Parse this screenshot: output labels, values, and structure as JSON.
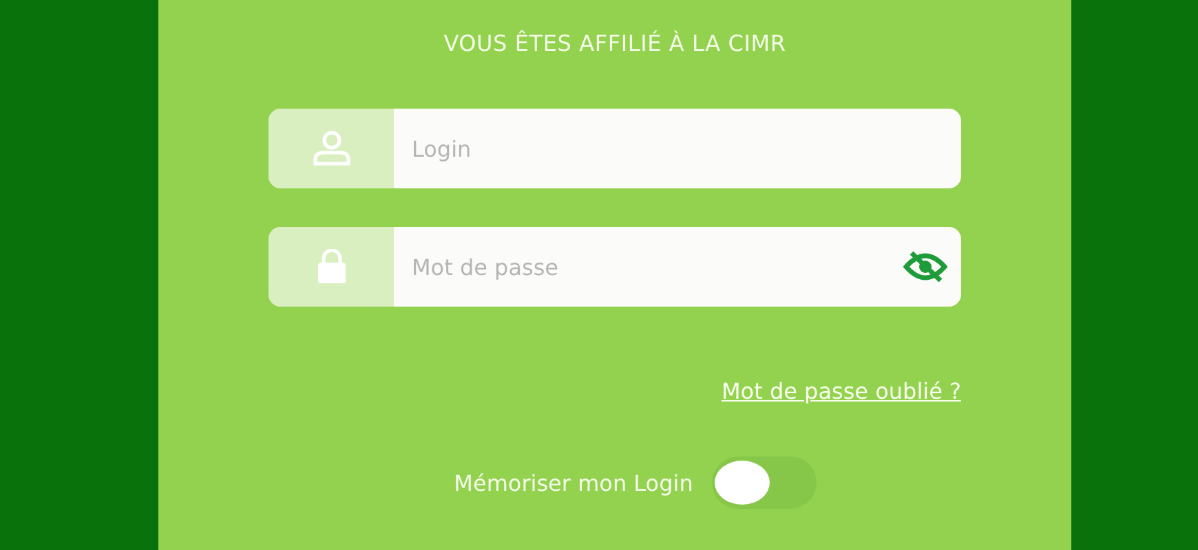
{
  "heading": "VOUS ÊTES AFFILIÉ À LA CIMR",
  "fields": [
    {
      "kind": "user",
      "placeholder": "Login"
    },
    {
      "kind": "password",
      "placeholder": "Mot de passe",
      "revealed": false
    }
  ],
  "forgot_link": "Mot de passe oublié ?",
  "remember": {
    "label": "Mémoriser mon Login",
    "on": false
  }
}
